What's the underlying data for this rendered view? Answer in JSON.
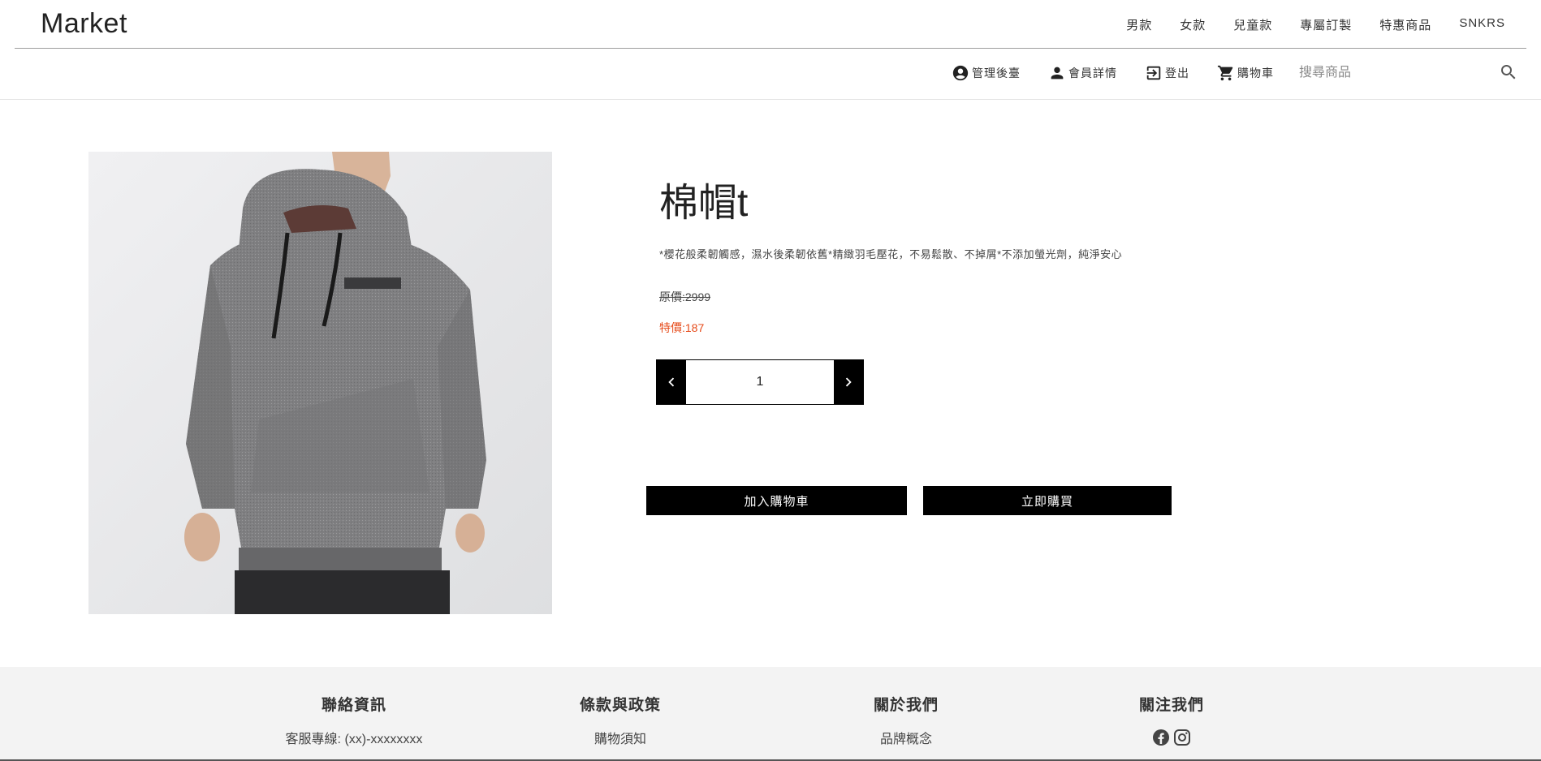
{
  "brand": "Market",
  "top_nav": [
    "男款",
    "女款",
    "兒童款",
    "專屬訂製",
    "特惠商品",
    "SNKRS"
  ],
  "sub_nav": {
    "admin": "管理後臺",
    "member": "會員詳情",
    "logout": "登出",
    "cart": "購物車"
  },
  "search": {
    "placeholder": "搜尋商品"
  },
  "product": {
    "title": "棉帽t",
    "description": "*櫻花般柔韌觸感，濕水後柔韌依舊*精緻羽毛壓花，不易鬆散、不掉屑*不添加螢光劑，純淨安心",
    "original_price": "原價:2999",
    "sale_price": "特價:187",
    "quantity": "1",
    "add_to_cart": "加入購物車",
    "buy_now": "立即購買",
    "sale_color": "#e64a19"
  },
  "footer": {
    "contact": {
      "title": "聯絡資訊",
      "line": "客服專線: (xx)-xxxxxxxx"
    },
    "terms": {
      "title": "條款與政策",
      "line": "購物須知"
    },
    "about": {
      "title": "關於我們",
      "line": "品牌概念"
    },
    "follow": {
      "title": "關注我們",
      "icons": [
        "facebook-icon",
        "instagram-icon"
      ]
    }
  }
}
